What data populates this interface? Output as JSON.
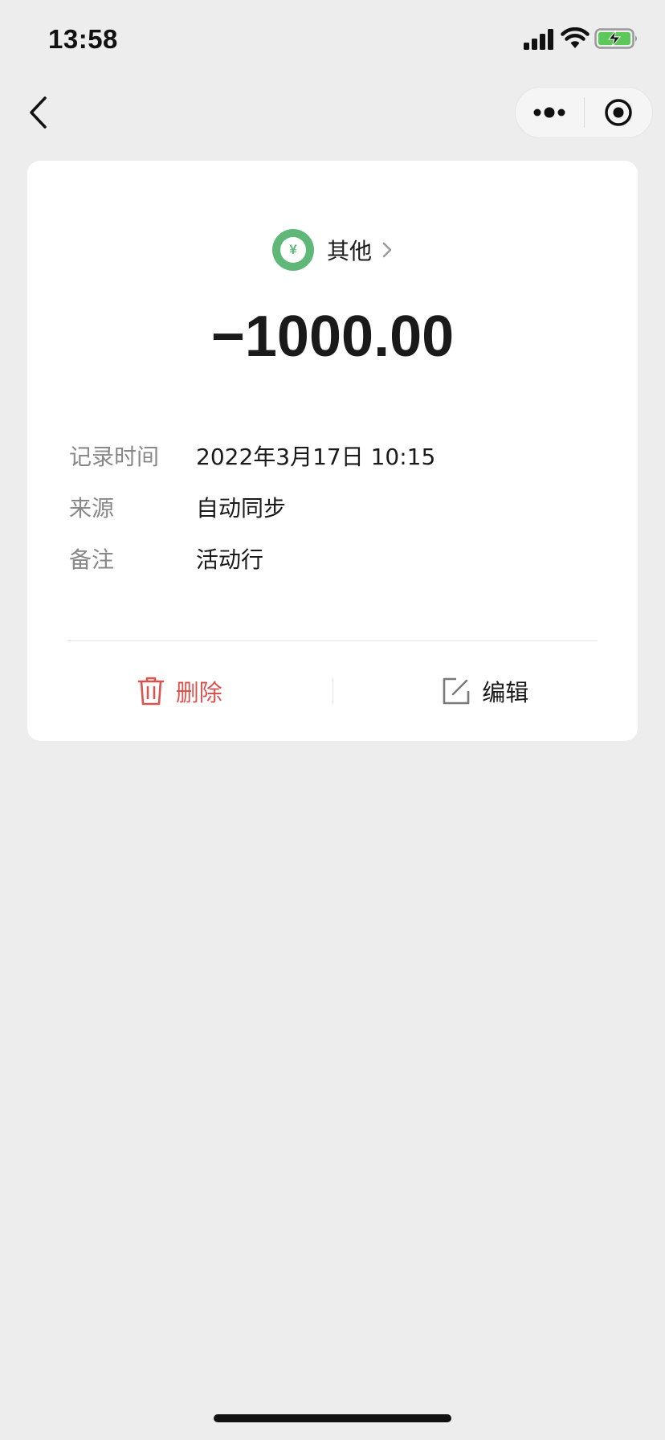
{
  "status_bar": {
    "time": "13:58",
    "icons": [
      "signal-icon",
      "wifi-icon",
      "battery-charging-icon"
    ]
  },
  "nav": {
    "back_icon": "chevron-left-icon",
    "capsule": {
      "more_icon": "more-dots-icon",
      "close_icon": "target-circle-icon"
    }
  },
  "record": {
    "category": {
      "icon": "yuan-coin-icon",
      "icon_glyph": "¥",
      "label": "其他",
      "chevron": "chevron-right-icon"
    },
    "amount": "−1000.00",
    "details": [
      {
        "label": "记录时间",
        "value": "2022年3月17日 10:15"
      },
      {
        "label": "来源",
        "value": "自动同步"
      },
      {
        "label": "备注",
        "value": "活动行"
      }
    ]
  },
  "actions": {
    "delete_label": "删除",
    "edit_label": "编辑"
  },
  "colors": {
    "background": "#ededed",
    "card": "#ffffff",
    "category_green": "#5fb878",
    "delete_red": "#d9534f",
    "label_gray": "#888888"
  }
}
